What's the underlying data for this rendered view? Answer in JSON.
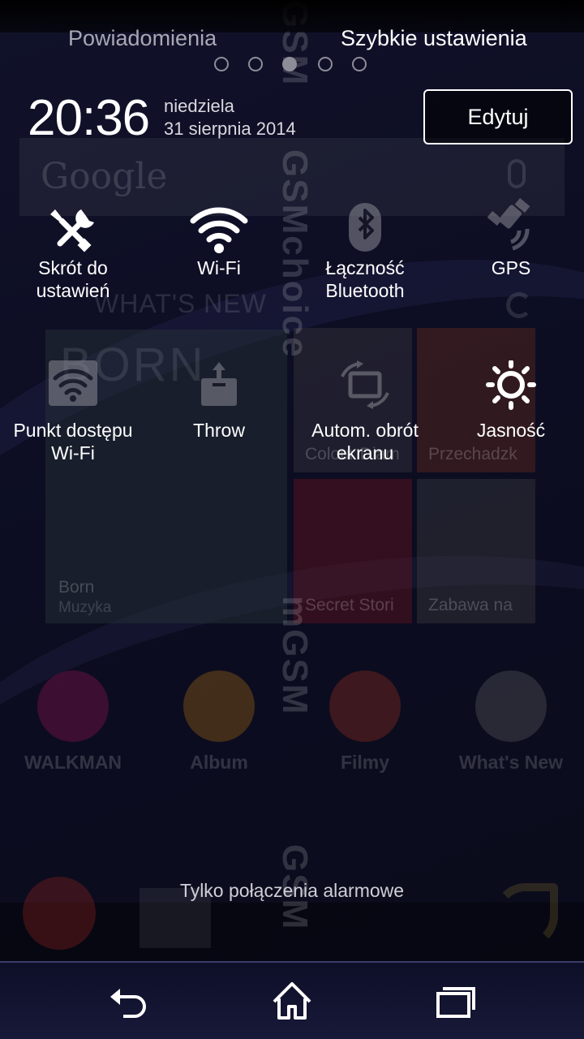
{
  "background": {
    "google_logo": "Google",
    "whats_new": "WHAT'S NEW",
    "big_tile": {
      "title": "Born",
      "subtitle": "Muzyka",
      "art": "BORN"
    },
    "tiles": [
      "Colour Diam",
      "Przechadzk",
      "Secret Stori",
      "Zabawa na"
    ],
    "apps": [
      "WALKMAN",
      "Album",
      "Filmy",
      "What's New"
    ],
    "watermark": [
      "GSM",
      "GSMchoice",
      "mGSM",
      "GSM"
    ]
  },
  "shade": {
    "tabs": {
      "notifications": "Powiadomienia",
      "quick_settings": "Szybkie ustawienia"
    },
    "page_dots": 5,
    "active_dot": 3,
    "clock": "20:36",
    "weekday": "niedziela",
    "date": "31 sierpnia 2014",
    "edit_label": "Edytuj"
  },
  "quick_settings": {
    "row1": [
      {
        "label": "Skrót do\nustawień",
        "icon": "tools-icon",
        "state": "active"
      },
      {
        "label": "Wi-Fi",
        "icon": "wifi-icon",
        "state": "active"
      },
      {
        "label": "Łączność\nBluetooth",
        "icon": "bluetooth-icon",
        "state": "inactive"
      },
      {
        "label": "GPS",
        "icon": "gps-icon",
        "state": "inactive"
      }
    ],
    "row2": [
      {
        "label": "Punkt dostępu\nWi-Fi",
        "icon": "hotspot-icon",
        "state": "inactive"
      },
      {
        "label": "Throw",
        "icon": "throw-icon",
        "state": "inactive"
      },
      {
        "label": "Autom. obrót\nekranu",
        "icon": "rotate-icon",
        "state": "inactive"
      },
      {
        "label": "Jasność",
        "icon": "brightness-icon",
        "state": "active"
      }
    ]
  },
  "emergency_text": "Tylko połączenia alarmowe",
  "navbar": {
    "back": "back-icon",
    "home": "home-icon",
    "recent": "recent-apps-icon"
  },
  "colors": {
    "accent": "#ffffff",
    "inactive_icon": "#8a8a94",
    "navbar": "#171938"
  }
}
